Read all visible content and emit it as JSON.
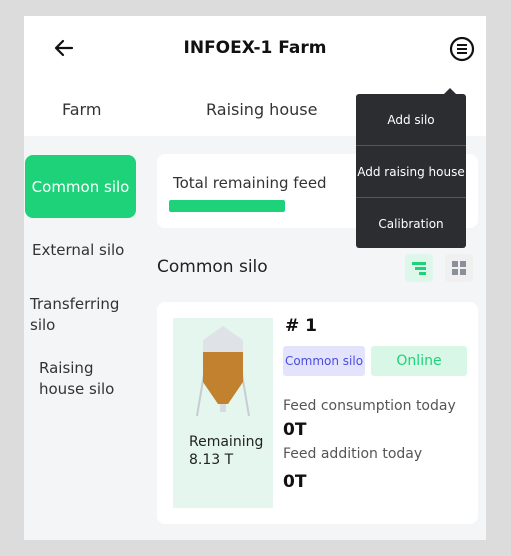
{
  "header": {
    "title": "INFOEX-1 Farm",
    "back_icon": "arrow-left-icon",
    "menu_icon": "menu-circle-icon"
  },
  "tabs": [
    {
      "label": "Farm"
    },
    {
      "label": "Raising house"
    }
  ],
  "dropdown": {
    "items": [
      {
        "label": "Add silo"
      },
      {
        "label": "Add raising house"
      },
      {
        "label": "Calibration"
      }
    ]
  },
  "sidebar": {
    "items": [
      {
        "label": "Common silo",
        "active": true
      },
      {
        "label": "External silo"
      },
      {
        "label": "Transferring silo"
      },
      {
        "label": "Raising house silo"
      }
    ]
  },
  "total": {
    "label": "Total remaining feed",
    "fill_fraction": 0.4
  },
  "section": {
    "title": "Common silo"
  },
  "silo": {
    "name": "# 1",
    "type_badge": "Common silo",
    "status_badge": "Online",
    "consumption_label": "Feed consumption today",
    "consumption_value": "0T",
    "addition_label": "Feed addition today",
    "addition_value": "0T",
    "remaining_label": "Remaining",
    "remaining_value": "8.13 T"
  },
  "colors": {
    "accent": "#1ed27a",
    "dropdown_bg": "#2b2d31",
    "badge_purple": "#4a4ce0"
  }
}
